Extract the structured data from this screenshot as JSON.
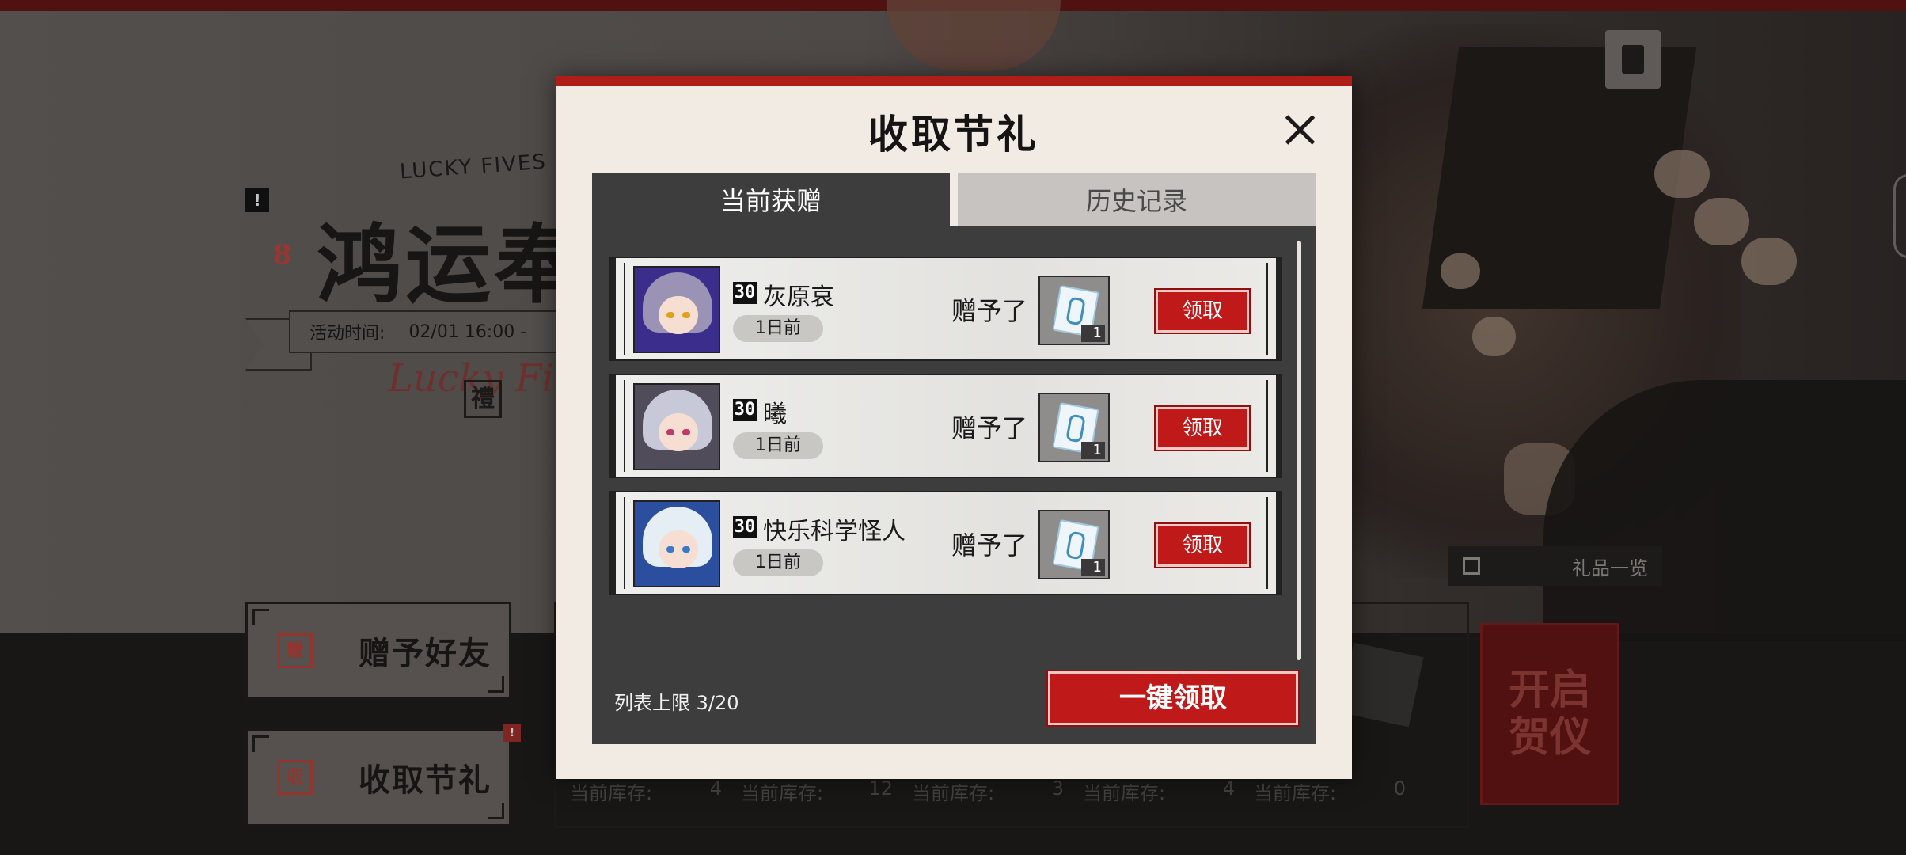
{
  "background": {
    "logo_subtitle": "LUCKY FIVES",
    "logo_title": "鸿运奉",
    "logo_script": "Lucky Fives",
    "logo_stamp": "禮",
    "title_mark": "8",
    "notice_icon": "!",
    "event_time_label": "活动时间:",
    "event_time_value": "02/01 16:00 -",
    "gift_list_label": "礼品一览",
    "open_ceremony_label": "开启贺仪",
    "side_buttons": [
      {
        "label": "赠予好友",
        "seal": "赠"
      },
      {
        "label": "收取节礼",
        "seal": "収",
        "badge": "!"
      }
    ],
    "stock": [
      {
        "label": "当前库存:",
        "value": "4"
      },
      {
        "label": "当前库存:",
        "value": "12"
      },
      {
        "label": "当前库存:",
        "value": "3"
      },
      {
        "label": "当前库存:",
        "value": "4"
      },
      {
        "label": "当前库存:",
        "value": "0"
      }
    ]
  },
  "modal": {
    "title": "收取节礼",
    "close_icon": "close-icon",
    "tabs": [
      {
        "label": "当前获赠",
        "active": true
      },
      {
        "label": "历史记录",
        "active": false
      }
    ],
    "gifts": [
      {
        "level": "30",
        "name": "灰原哀",
        "time": "1日前",
        "action_text": "赠予了",
        "item_count": "1",
        "claim_label": "领取",
        "avatar_hair": "#9a93b5",
        "avatar_bg": "#3a2d8c",
        "avatar_eye": "#e0a21a"
      },
      {
        "level": "30",
        "name": "曦",
        "time": "1日前",
        "action_text": "赠予了",
        "item_count": "1",
        "claim_label": "领取",
        "avatar_hair": "#c7c8d8",
        "avatar_bg": "#504c5a",
        "avatar_eye": "#c23a6a"
      },
      {
        "level": "30",
        "name": "快乐科学怪人",
        "time": "1日前",
        "action_text": "赠予了",
        "item_count": "1",
        "claim_label": "领取",
        "avatar_hair": "#e5edf5",
        "avatar_bg": "#2b4f9e",
        "avatar_eye": "#3a78c8"
      }
    ],
    "list_limit": "列表上限 3/20",
    "claim_all_label": "一键领取"
  },
  "colors": {
    "accent_red": "#c0191a",
    "panel_dark": "#3e3d3d",
    "modal_bg": "#f1ebe3"
  }
}
